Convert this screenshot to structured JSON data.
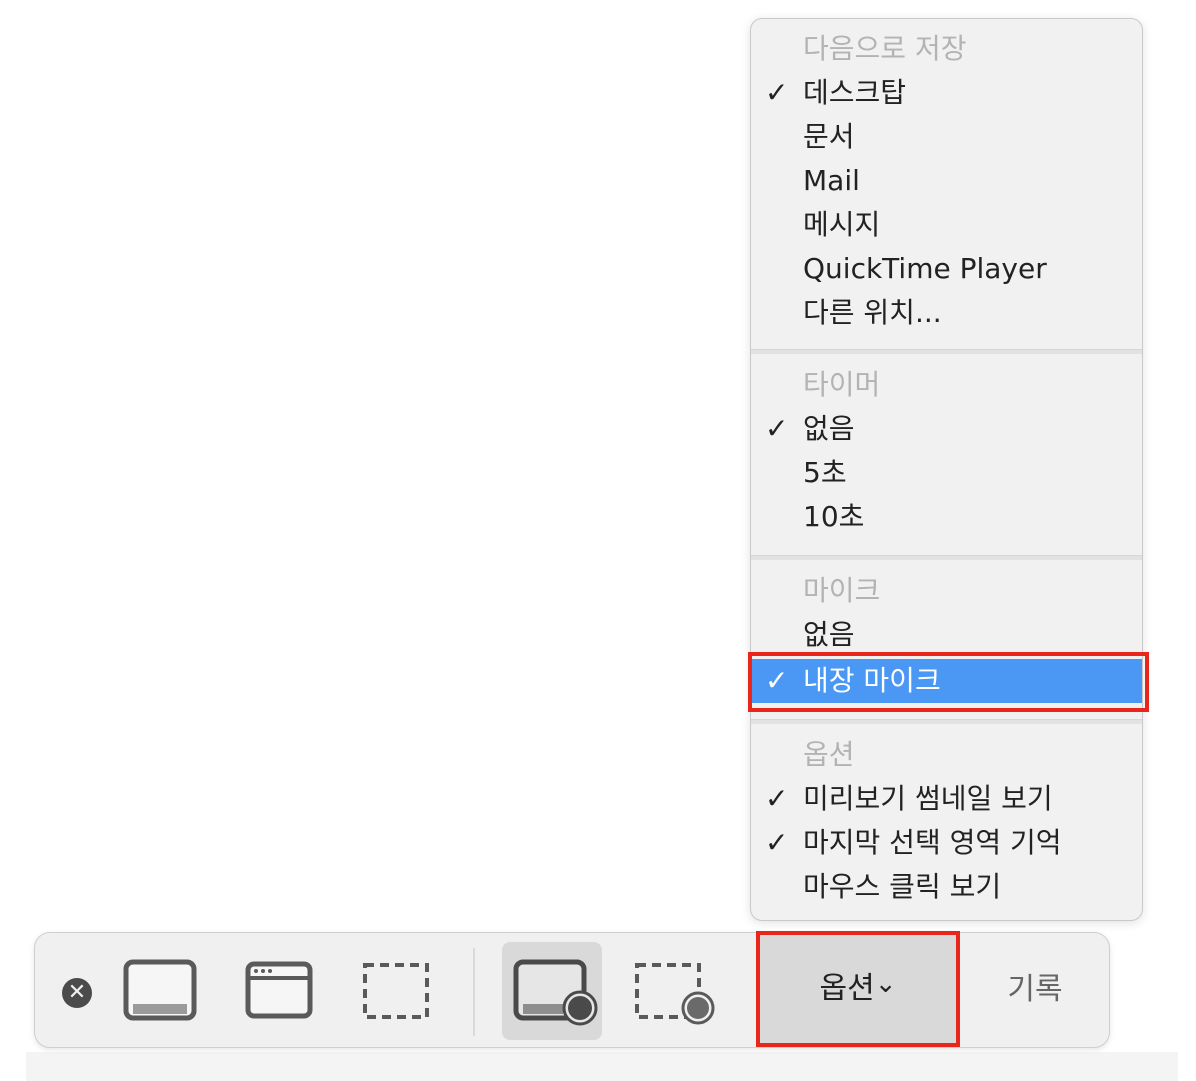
{
  "menu": {
    "save_header": "다음으로 저장",
    "save_items": [
      {
        "label": "데스크탑",
        "checked": true
      },
      {
        "label": "문서",
        "checked": false
      },
      {
        "label": "Mail",
        "checked": false
      },
      {
        "label": "메시지",
        "checked": false
      },
      {
        "label": "QuickTime Player",
        "checked": false
      },
      {
        "label": "다른 위치...",
        "checked": false
      }
    ],
    "timer_header": "타이머",
    "timer_items": [
      {
        "label": "없음",
        "checked": true
      },
      {
        "label": "5초",
        "checked": false
      },
      {
        "label": "10초",
        "checked": false
      }
    ],
    "mic_header": "마이크",
    "mic_items": [
      {
        "label": "없음",
        "checked": false
      },
      {
        "label": "내장 마이크",
        "checked": true,
        "selected": true
      }
    ],
    "options_header": "옵션",
    "options_items": [
      {
        "label": "미리보기 썸네일 보기",
        "checked": true
      },
      {
        "label": "마지막 선택 영역 기억",
        "checked": true
      },
      {
        "label": "마우스 클릭 보기",
        "checked": false
      }
    ],
    "checkmark": "✓"
  },
  "toolbar": {
    "close_glyph": "✕",
    "capture_screen_icon": "screen-capture-icon",
    "capture_window_icon": "window-capture-icon",
    "capture_selection_icon": "selection-capture-icon",
    "record_screen_icon": "screen-record-icon",
    "record_selection_icon": "selection-record-icon",
    "options_label": "옵션",
    "options_chevron": "⌄",
    "record_label": "기록"
  },
  "colors": {
    "selection_blue": "#4a97f4",
    "highlight_red": "#e8261c"
  }
}
